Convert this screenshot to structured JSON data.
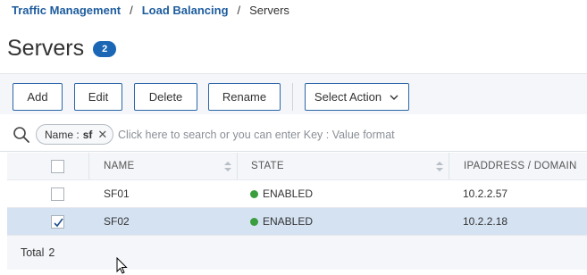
{
  "breadcrumb": {
    "items": [
      "Traffic Management",
      "Load Balancing",
      "Servers"
    ],
    "separator": "/"
  },
  "page": {
    "title": "Servers",
    "count": "2"
  },
  "toolbar": {
    "add_label": "Add",
    "edit_label": "Edit",
    "delete_label": "Delete",
    "rename_label": "Rename",
    "select_action_label": "Select Action"
  },
  "search": {
    "chip_key": "Name :",
    "chip_value": "sf",
    "chip_close": "✕",
    "placeholder": "Click here to search or you can enter Key : Value format"
  },
  "table": {
    "columns": [
      "NAME",
      "STATE",
      "IPADDRESS / DOMAIN"
    ],
    "rows": [
      {
        "name": "SF01",
        "state": "ENABLED",
        "ip": "10.2.2.57",
        "selected": false
      },
      {
        "name": "SF02",
        "state": "ENABLED",
        "ip": "10.2.2.18",
        "selected": true
      }
    ]
  },
  "footer": {
    "total_label": "Total",
    "total_value": "2"
  },
  "colors": {
    "accent": "#1b67b5",
    "link": "#1d5c9e",
    "enabled": "#3a9e3e",
    "selected_row": "#d4e2f2"
  },
  "icons": [
    "search-icon",
    "close-icon",
    "chevron-down-icon",
    "sort-icon",
    "checkmark-icon",
    "mouse-cursor-icon"
  ]
}
